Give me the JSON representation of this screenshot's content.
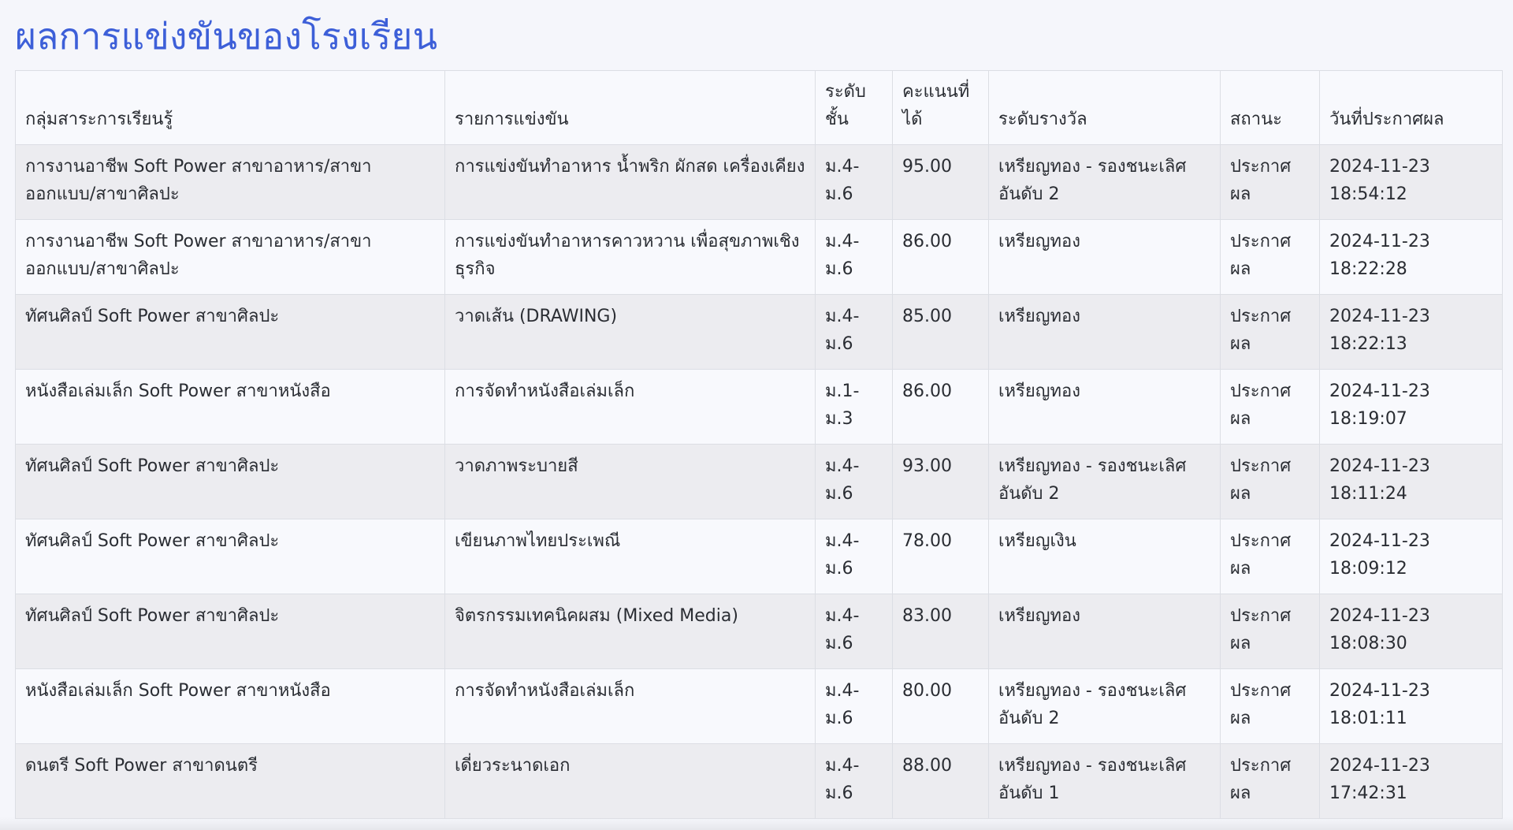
{
  "page": {
    "title": "ผลการแข่งขันของโรงเรียน"
  },
  "table": {
    "headers": [
      "กลุ่มสาระการเรียนรู้",
      "รายการแข่งขัน",
      "ระดับชั้น",
      "คะแนนที่ได้",
      "ระดับรางวัล",
      "สถานะ",
      "วันที่ประกาศผล"
    ],
    "rows": [
      [
        "การงานอาชีพ Soft Power สาขาอาหาร/สาขาออกแบบ/สาขาศิลปะ",
        "การแข่งขันทำอาหาร น้ำพริก ผักสด เครื่องเคียง",
        "ม.4-ม.6",
        "95.00",
        "เหรียญทอง - รองชนะเลิศอันดับ 2",
        "ประกาศผล",
        "2024-11-23 18:54:12"
      ],
      [
        "การงานอาชีพ Soft Power สาขาอาหาร/สาขาออกแบบ/สาขาศิลปะ",
        "การแข่งขันทำอาหารคาวหวาน เพื่อสุขภาพเชิงธุรกิจ",
        "ม.4-ม.6",
        "86.00",
        "เหรียญทอง",
        "ประกาศผล",
        "2024-11-23 18:22:28"
      ],
      [
        "ทัศนศิลป์ Soft Power สาขาศิลปะ",
        "วาดเส้น (DRAWING)",
        "ม.4-ม.6",
        "85.00",
        "เหรียญทอง",
        "ประกาศผล",
        "2024-11-23 18:22:13"
      ],
      [
        "หนังสือเล่มเล็ก Soft Power สาขาหนังสือ",
        "การจัดทำหนังสือเล่มเล็ก",
        "ม.1-ม.3",
        "86.00",
        "เหรียญทอง",
        "ประกาศผล",
        "2024-11-23 18:19:07"
      ],
      [
        "ทัศนศิลป์ Soft Power สาขาศิลปะ",
        "วาดภาพระบายสี",
        "ม.4-ม.6",
        "93.00",
        "เหรียญทอง - รองชนะเลิศอันดับ 2",
        "ประกาศผล",
        "2024-11-23 18:11:24"
      ],
      [
        "ทัศนศิลป์ Soft Power สาขาศิลปะ",
        "เขียนภาพไทยประเพณี",
        "ม.4-ม.6",
        "78.00",
        "เหรียญเงิน",
        "ประกาศผล",
        "2024-11-23 18:09:12"
      ],
      [
        "ทัศนศิลป์ Soft Power สาขาศิลปะ",
        "จิตรกรรมเทคนิคผสม (Mixed Media)",
        "ม.4-ม.6",
        "83.00",
        "เหรียญทอง",
        "ประกาศผล",
        "2024-11-23 18:08:30"
      ],
      [
        "หนังสือเล่มเล็ก Soft Power สาขาหนังสือ",
        "การจัดทำหนังสือเล่มเล็ก",
        "ม.4-ม.6",
        "80.00",
        "เหรียญทอง - รองชนะเลิศอันดับ 2",
        "ประกาศผล",
        "2024-11-23 18:01:11"
      ],
      [
        "ดนตรี Soft Power สาขาดนตรี",
        "เดี่ยวระนาดเอก",
        "ม.4-ม.6",
        "88.00",
        "เหรียญทอง - รองชนะเลิศอันดับ 1",
        "ประกาศผล",
        "2024-11-23 17:42:31"
      ]
    ]
  }
}
